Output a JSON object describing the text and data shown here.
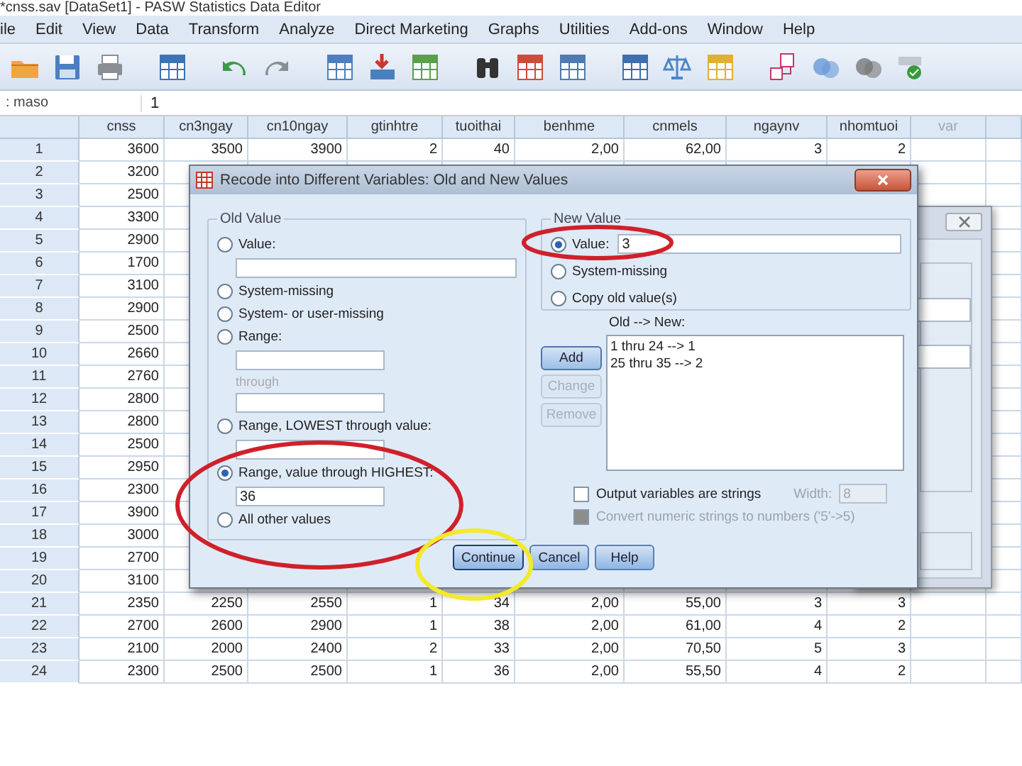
{
  "window": {
    "title": "*cnss.sav [DataSet1] - PASW Statistics Data Editor"
  },
  "menu": [
    "ile",
    "Edit",
    "View",
    "Data",
    "Transform",
    "Analyze",
    "Direct Marketing",
    "Graphs",
    "Utilities",
    "Add-ons",
    "Window",
    "Help"
  ],
  "cell_editor": {
    "variable": ": maso",
    "value": "1"
  },
  "table": {
    "columns": [
      {
        "label": "cnss",
        "kind": "variable"
      },
      {
        "label": "cn3ngay",
        "kind": "variable"
      },
      {
        "label": "cn10ngay",
        "kind": "variable"
      },
      {
        "label": "gtinhtre",
        "kind": "variable"
      },
      {
        "label": "tuoithai",
        "kind": "variable"
      },
      {
        "label": "benhme",
        "kind": "variable"
      },
      {
        "label": "cnmels",
        "kind": "variable"
      },
      {
        "label": "ngaynv",
        "kind": "variable"
      },
      {
        "label": "nhomtuoi",
        "kind": "variable"
      },
      {
        "label": "var",
        "kind": "empty"
      }
    ],
    "rows": [
      {
        "row": "1",
        "cells": [
          "3600",
          "3500",
          "3900",
          "2",
          "40",
          "2,00",
          "62,00",
          "3",
          "2"
        ]
      },
      {
        "row": "2",
        "cells": [
          "3200"
        ]
      },
      {
        "row": "3",
        "cells": [
          "2500"
        ]
      },
      {
        "row": "4",
        "cells": [
          "3300"
        ]
      },
      {
        "row": "5",
        "cells": [
          "2900"
        ]
      },
      {
        "row": "6",
        "cells": [
          "1700"
        ]
      },
      {
        "row": "7",
        "cells": [
          "3100"
        ]
      },
      {
        "row": "8",
        "cells": [
          "2900"
        ]
      },
      {
        "row": "9",
        "cells": [
          "2500"
        ]
      },
      {
        "row": "10",
        "cells": [
          "2660"
        ]
      },
      {
        "row": "11",
        "cells": [
          "2760"
        ]
      },
      {
        "row": "12",
        "cells": [
          "2800"
        ]
      },
      {
        "row": "13",
        "cells": [
          "2800"
        ]
      },
      {
        "row": "14",
        "cells": [
          "2500"
        ]
      },
      {
        "row": "15",
        "cells": [
          "2950"
        ]
      },
      {
        "row": "16",
        "cells": [
          "2300"
        ]
      },
      {
        "row": "17",
        "cells": [
          "3900"
        ]
      },
      {
        "row": "18",
        "cells": [
          "3000"
        ]
      },
      {
        "row": "19",
        "cells": [
          "2700"
        ]
      },
      {
        "row": "20",
        "cells": [
          "3100"
        ]
      },
      {
        "row": "21",
        "cells": [
          "2350",
          "2250",
          "2550",
          "1",
          "34",
          "2,00",
          "55,00",
          "3",
          "3"
        ]
      },
      {
        "row": "22",
        "cells": [
          "2700",
          "2600",
          "2900",
          "1",
          "38",
          "2,00",
          "61,00",
          "4",
          "2"
        ]
      },
      {
        "row": "23",
        "cells": [
          "2100",
          "2000",
          "2400",
          "2",
          "33",
          "2,00",
          "70,50",
          "5",
          "3"
        ]
      },
      {
        "row": "24",
        "cells": [
          "2300",
          "2500",
          "2500",
          "1",
          "36",
          "2,00",
          "55,50",
          "4",
          "2"
        ]
      }
    ]
  },
  "dialog": {
    "title": "Recode into Different Variables: Old and New Values",
    "old_value": {
      "title": "Old Value",
      "options": [
        {
          "kind": "value",
          "label": "Value:",
          "selected": false
        },
        {
          "kind": "plain",
          "label": "System-missing",
          "selected": false
        },
        {
          "kind": "plain",
          "label": "System- or user-missing",
          "selected": false
        },
        {
          "kind": "range",
          "label": "Range:",
          "through": "through",
          "selected": false
        },
        {
          "kind": "lowest",
          "label": "Range, LOWEST through value:",
          "selected": false
        },
        {
          "kind": "highest",
          "label": "Range, value through HIGHEST:",
          "value": "36",
          "selected": true
        },
        {
          "kind": "plain",
          "label": "All other values",
          "selected": false
        }
      ]
    },
    "new_value": {
      "title": "New Value",
      "options": [
        {
          "kind": "value",
          "label": "Value:",
          "value": "3",
          "selected": true
        },
        {
          "kind": "plain",
          "label": "System-missing",
          "selected": false
        },
        {
          "kind": "plain",
          "label": "Copy old value(s)",
          "selected": false
        }
      ]
    },
    "mapping": {
      "label": "Old --> New:",
      "items": [
        "1 thru 24 --> 1",
        "25 thru 35 --> 2"
      ]
    },
    "list_buttons": [
      {
        "label": "Add",
        "disabled": false
      },
      {
        "label": "Change",
        "disabled": true
      },
      {
        "label": "Remove",
        "disabled": true
      }
    ],
    "output_strings": {
      "label": "Output variables are strings",
      "checked": false,
      "disabled": false
    },
    "width": {
      "label": "Width:",
      "value": "8",
      "disabled": true
    },
    "convert": {
      "label": "Convert numeric strings to numbers ('5'->5)",
      "checked": false,
      "disabled": true
    },
    "buttons": [
      {
        "label": "Continue",
        "default": true
      },
      {
        "label": "Cancel",
        "default": false
      },
      {
        "label": "Help",
        "default": false
      }
    ]
  }
}
